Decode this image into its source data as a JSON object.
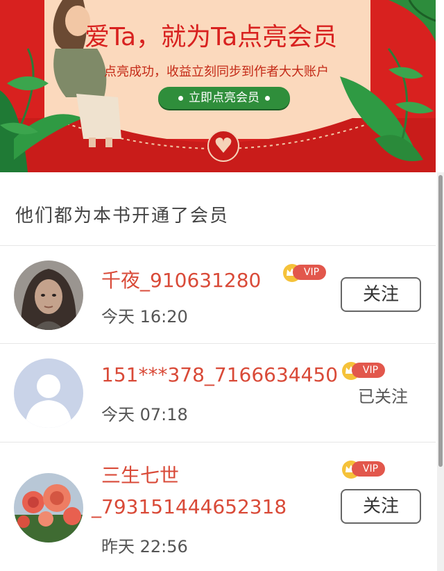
{
  "banner": {
    "title": "爱Ta，就为Ta点亮会员",
    "subtitle": "点亮成功，收益立刻同步到作者大大账户",
    "button_label": "立即点亮会员"
  },
  "section": {
    "title": "他们都为本书开通了会员"
  },
  "members": [
    {
      "name": "千夜_910631280",
      "time": "今天 16:20",
      "badge": "VIP",
      "action": "关注",
      "followed": false,
      "avatar": "portrait-photo"
    },
    {
      "name": "151***378_7166634450",
      "time": "今天 07:18",
      "badge": "VIP",
      "action": "已关注",
      "followed": true,
      "avatar": "default-user-silhouette"
    },
    {
      "name_line1": "三生七世",
      "name_line2": "_793151444652318",
      "time": "昨天 22:56",
      "badge": "VIP",
      "action": "关注",
      "followed": false,
      "avatar": "flower-photo"
    }
  ],
  "colors": {
    "banner_red": "#d8211f",
    "name_red": "#d94a38",
    "vip_red": "#e2574c",
    "button_green": "#2f8e3b"
  }
}
